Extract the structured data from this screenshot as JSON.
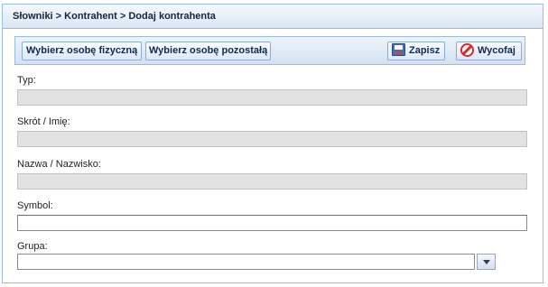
{
  "breadcrumb": "Słowniki > Kontrahent > Dodaj kontrahenta",
  "toolbar": {
    "select_natural_person": "Wybierz osobę fizyczną",
    "select_other_person": "Wybierz osobę pozostałą",
    "save": "Zapisz",
    "cancel": "Wycofaj",
    "save_icon": "floppy-disk-icon",
    "cancel_icon": "no-entry-icon"
  },
  "form": {
    "type_label": "Typ:",
    "type_value": "",
    "short_label": "Skrót / Imię:",
    "short_value": "",
    "name_label": "Nazwa / Nazwisko:",
    "name_value": "",
    "symbol_label": "Symbol:",
    "symbol_value": "",
    "group_label": "Grupa:",
    "group_value": ""
  },
  "colors": {
    "panel_border": "#99bbe8",
    "disabled_field": "#e2e2e2",
    "cancel_red": "#d62b2b"
  }
}
